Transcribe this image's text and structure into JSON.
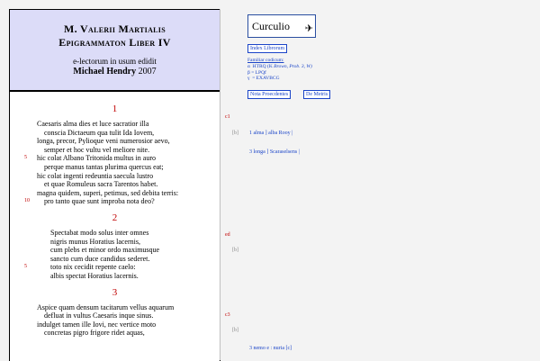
{
  "header": {
    "line1": "M. Valerii Martialis",
    "line2": "Epigrammaton Liber IV",
    "subtitle": "e-lectorum in usum edidit",
    "author_name": "Michael Hendry",
    "year": "2007"
  },
  "poems": [
    {
      "number": "1",
      "lines": [
        {
          "n": "",
          "text": "Caesaris alma dies et luce sacratior illa",
          "indent": false
        },
        {
          "n": "",
          "text": "conscia Dictaeum qua tulit Ida Iovem,",
          "indent": true
        },
        {
          "n": "",
          "text": "longa, precor, Pylioque veni numerosior aevo,",
          "indent": false
        },
        {
          "n": "",
          "text": "semper et hoc vultu vel meliore nite.",
          "indent": true
        },
        {
          "n": "5",
          "text": "hic colat Albano Tritonida multus in auro",
          "indent": false
        },
        {
          "n": "",
          "text": "perque manus tantas plurima quercus eat;",
          "indent": true
        },
        {
          "n": "",
          "text": "hic colat ingenti redeuntia saecula lustro",
          "indent": false
        },
        {
          "n": "",
          "text": "et quae Romuleus sacra Tarentos habet.",
          "indent": true
        },
        {
          "n": "",
          "text": "magna quidem, superi, petimus, sed debita terris:",
          "indent": false
        },
        {
          "n": "10",
          "text": "pro tanto quae sunt improba nota deo?",
          "indent": true
        }
      ]
    },
    {
      "number": "2",
      "lines": [
        {
          "n": "",
          "text": "Spectabat modo solus inter omnes",
          "indent": false
        },
        {
          "n": "",
          "text": "nigris munus Horatius lacernis,",
          "indent": false
        },
        {
          "n": "",
          "text": "cum plebs et minor ordo maximusque",
          "indent": false
        },
        {
          "n": "",
          "text": "sancto cum duce candidus sederet.",
          "indent": false
        },
        {
          "n": "5",
          "text": "toto nix cecidit repente caelo:",
          "indent": false
        },
        {
          "n": "",
          "text": "albis spectat Horatius lacernis.",
          "indent": false
        }
      ]
    },
    {
      "number": "3",
      "lines": [
        {
          "n": "",
          "text": "Aspice quam densum tacitarum vellus aquarum",
          "indent": false
        },
        {
          "n": "",
          "text": "defluat in vultus Caesaris inque sinus.",
          "indent": true
        },
        {
          "n": "",
          "text": "indulget tamen ille Iovi, nec vertice moto",
          "indent": false
        },
        {
          "n": "",
          "text": "concretas pigro frigore ridet aquas,",
          "indent": true
        }
      ]
    }
  ],
  "sidebar": {
    "logo_text": "Curculio",
    "logo_icon": "bird-icon",
    "index_button": "Index Librorum",
    "editions_heading": "Familiar codicum:",
    "editions": [
      {
        "siglum": "α",
        "text": "HTRQ (K",
        "extra": "Brown, Prob. 3, W)"
      },
      {
        "siglum": "β",
        "text": "= LPQf",
        "extra": ""
      },
      {
        "siglum": "γ",
        "text": "= EXAVBCG",
        "extra": ""
      }
    ],
    "notes_button": "Nota Proecdentes",
    "meter_button": "De Metris",
    "notes": [
      {
        "mark": "c1",
        "text": ""
      },
      {
        "mark": "[b]",
        "text": "1 alma ] alba Rooy |"
      },
      {
        "mark": "",
        "text": "3 longa ] Scaraselsens |"
      },
      {
        "mark": "ed",
        "text": ""
      },
      {
        "mark": "[b]",
        "text": ""
      },
      {
        "mark": "c3",
        "text": ""
      },
      {
        "mark": "[b]",
        "text": ""
      },
      {
        "mark": "",
        "text": "3 nemo e : nuria [c]"
      }
    ]
  },
  "colors": {
    "title_bg": "#dcdcf8",
    "poem_number": "#c00000",
    "link_blue": "#1a44c8",
    "page_bg": "#f3f3f3"
  }
}
